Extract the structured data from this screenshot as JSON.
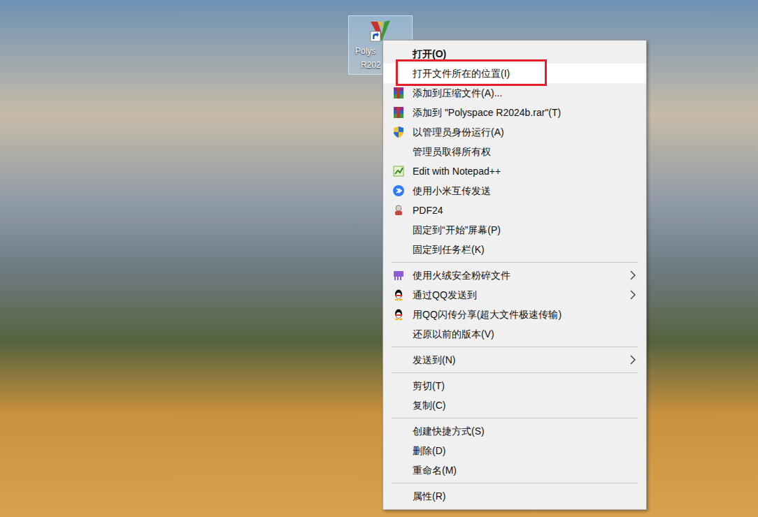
{
  "desktop": {
    "icons": [
      {
        "label_lines": [
          "Polys",
          "R202"
        ],
        "selected": true
      }
    ]
  },
  "context_menu": {
    "groups": [
      [
        {
          "label": "打开(O)",
          "bold": true,
          "highlighted": false,
          "annotated": false,
          "submenu": false
        },
        {
          "label": "打开文件所在的位置(I)",
          "bold": false,
          "highlighted": true,
          "annotated": true,
          "submenu": false
        },
        {
          "label": "添加到压缩文件(A)...",
          "bold": false,
          "highlighted": false,
          "annotated": false,
          "submenu": false
        },
        {
          "label": "添加到 \"Polyspace R2024b.rar\"(T)",
          "bold": false,
          "highlighted": false,
          "annotated": false,
          "submenu": false
        },
        {
          "label": "以管理员身份运行(A)",
          "bold": false,
          "highlighted": false,
          "annotated": false,
          "submenu": false
        },
        {
          "label": "管理员取得所有权",
          "bold": false,
          "highlighted": false,
          "annotated": false,
          "submenu": false
        },
        {
          "label": "Edit with Notepad++",
          "bold": false,
          "highlighted": false,
          "annotated": false,
          "submenu": false
        },
        {
          "label": "使用小米互传发送",
          "bold": false,
          "highlighted": false,
          "annotated": false,
          "submenu": false
        },
        {
          "label": "PDF24",
          "bold": false,
          "highlighted": false,
          "annotated": false,
          "submenu": false
        },
        {
          "label": "固定到“开始”屏幕(P)",
          "bold": false,
          "highlighted": false,
          "annotated": false,
          "submenu": false
        },
        {
          "label": "固定到任务栏(K)",
          "bold": false,
          "highlighted": false,
          "annotated": false,
          "submenu": false
        }
      ],
      [
        {
          "label": "使用火绒安全粉碎文件",
          "bold": false,
          "highlighted": false,
          "annotated": false,
          "submenu": true
        },
        {
          "label": "通过QQ发送到",
          "bold": false,
          "highlighted": false,
          "annotated": false,
          "submenu": true
        },
        {
          "label": "用QQ闪传分享(超大文件极速传输)",
          "bold": false,
          "highlighted": false,
          "annotated": false,
          "submenu": false
        },
        {
          "label": "还原以前的版本(V)",
          "bold": false,
          "highlighted": false,
          "annotated": false,
          "submenu": false
        }
      ],
      [
        {
          "label": "发送到(N)",
          "bold": false,
          "highlighted": false,
          "annotated": false,
          "submenu": true
        }
      ],
      [
        {
          "label": "剪切(T)",
          "bold": false,
          "highlighted": false,
          "annotated": false,
          "submenu": false
        },
        {
          "label": "复制(C)",
          "bold": false,
          "highlighted": false,
          "annotated": false,
          "submenu": false
        }
      ],
      [
        {
          "label": "创建快捷方式(S)",
          "bold": false,
          "highlighted": false,
          "annotated": false,
          "submenu": false
        },
        {
          "label": "删除(D)",
          "bold": false,
          "highlighted": false,
          "annotated": false,
          "submenu": false
        },
        {
          "label": "重命名(M)",
          "bold": false,
          "highlighted": false,
          "annotated": false,
          "submenu": false
        }
      ],
      [
        {
          "label": "属性(R)",
          "bold": false,
          "highlighted": false,
          "annotated": false,
          "submenu": false
        }
      ]
    ]
  }
}
